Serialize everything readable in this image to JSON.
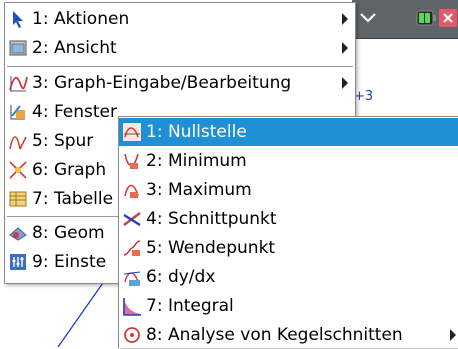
{
  "main_menu": {
    "items": [
      {
        "label": "1: Aktionen",
        "icon": "pointer-arrow-icon",
        "has_submenu": true
      },
      {
        "label": "2: Ansicht",
        "icon": "view-icon",
        "has_submenu": true
      },
      {
        "label": "3: Graph-Eingabe/Bearbeitung",
        "icon": "function-graph-icon",
        "has_submenu": true
      },
      {
        "label": "4: Fenster",
        "icon": "window-zoom-icon",
        "has_submenu": true
      },
      {
        "label": "5: Spur",
        "icon": "trace-icon",
        "has_submenu": true
      },
      {
        "label": "6: Graph",
        "icon": "analyze-graph-icon",
        "has_submenu": true
      },
      {
        "label": "7: Tabelle",
        "icon": "table-icon",
        "has_submenu": true
      },
      {
        "label": "8: Geom",
        "icon": "geometry-icon",
        "has_submenu": true
      },
      {
        "label": "9: Einste",
        "icon": "settings-icon",
        "has_submenu": true
      }
    ]
  },
  "sub_menu": {
    "items": [
      {
        "label": "1: Nullstelle",
        "icon": "zero-icon",
        "selected": true
      },
      {
        "label": "2: Minimum",
        "icon": "minimum-icon"
      },
      {
        "label": "3: Maximum",
        "icon": "maximum-icon"
      },
      {
        "label": "4: Schnittpunkt",
        "icon": "intersection-icon"
      },
      {
        "label": "5: Wendepunkt",
        "icon": "inflection-icon"
      },
      {
        "label": "6: dy/dx",
        "icon": "derivative-icon"
      },
      {
        "label": "7: Integral",
        "icon": "integral-icon"
      },
      {
        "label": "8: Analyse von Kegelschnitten",
        "icon": "conic-analysis-icon",
        "has_submenu": true
      }
    ]
  },
  "graph": {
    "visible_label": "+3"
  },
  "colors": {
    "selection": "#1f8fd6",
    "graph_line": "#1f3fbf",
    "statusbar": "#5f6469"
  }
}
